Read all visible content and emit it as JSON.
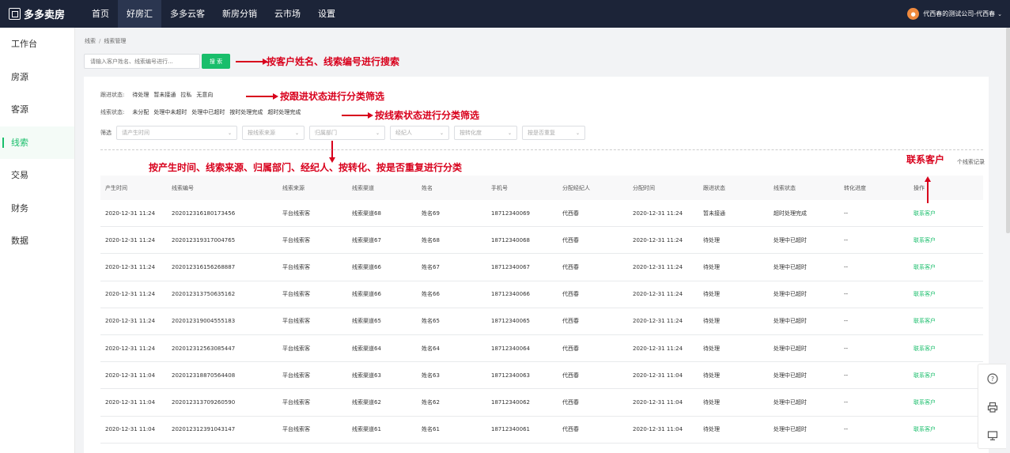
{
  "brand": {
    "name": "多多卖房"
  },
  "nav": {
    "items": [
      {
        "label": "首页"
      },
      {
        "label": "好房汇"
      },
      {
        "label": "多多云客"
      },
      {
        "label": "新房分销"
      },
      {
        "label": "云市场"
      },
      {
        "label": "设置"
      }
    ]
  },
  "user": {
    "name": "代西春的测试公司-代西春"
  },
  "sidebar": {
    "items": [
      {
        "label": "工作台"
      },
      {
        "label": "房源"
      },
      {
        "label": "客源"
      },
      {
        "label": "线索"
      },
      {
        "label": "交易"
      },
      {
        "label": "财务"
      },
      {
        "label": "数据"
      }
    ]
  },
  "breadcrumb": {
    "parent": "线索",
    "current": "线索管理"
  },
  "search": {
    "placeholder": "请输入客户姓名、线索编号进行...",
    "button": "搜 索"
  },
  "filters": {
    "follow_status": {
      "label": "跟进状态:",
      "options": [
        "待处理",
        "暂未接通",
        "拉私",
        "无意向"
      ]
    },
    "clue_status": {
      "label": "线索状态:",
      "options": [
        "未分配",
        "处理中未超时",
        "处理中已超时",
        "按时处理完成",
        "超时处理完成"
      ]
    },
    "screen_label": "筛选",
    "dropdowns": [
      "请产生时间",
      "按线索来源",
      "归属部门",
      "经纪人",
      "按转化度",
      "按是否重复"
    ]
  },
  "count_text": "个线索记录",
  "table": {
    "headers": [
      "产生时间",
      "线索编号",
      "线索来源",
      "线索渠道",
      "姓名",
      "手机号",
      "分配经纪人",
      "分配时间",
      "跟进状态",
      "线索状态",
      "转化进度",
      "操作"
    ],
    "rows": [
      [
        "2020-12-31 11:24",
        "2020123161801734​56",
        "平台线索客",
        "线索渠道68",
        "姓名69",
        "18712340069",
        "代西春",
        "2020-12-31 11:24",
        "暂未接通",
        "超时处理完成",
        "--",
        "联系客户"
      ],
      [
        "2020-12-31 11:24",
        "202012319317004765",
        "平台线索客",
        "线索渠道67",
        "姓名68",
        "18712340068",
        "代西春",
        "2020-12-31 11:24",
        "待处理",
        "处理中已超时",
        "--",
        "联系客户"
      ],
      [
        "2020-12-31 11:24",
        "202012316156268887",
        "平台线索客",
        "线索渠道66",
        "姓名67",
        "18712340067",
        "代西春",
        "2020-12-31 11:24",
        "待处理",
        "处理中已超时",
        "--",
        "联系客户"
      ],
      [
        "2020-12-31 11:24",
        "202012313750635162",
        "平台线索客",
        "线索渠道66",
        "姓名66",
        "18712340066",
        "代西春",
        "2020-12-31 11:24",
        "待处理",
        "处理中已超时",
        "--",
        "联系客户"
      ],
      [
        "2020-12-31 11:24",
        "202012319004555183",
        "平台线索客",
        "线索渠道65",
        "姓名65",
        "18712340065",
        "代西春",
        "2020-12-31 11:24",
        "待处理",
        "处理中已超时",
        "--",
        "联系客户"
      ],
      [
        "2020-12-31 11:24",
        "202012312563085447",
        "平台线索客",
        "线索渠道64",
        "姓名64",
        "18712340064",
        "代西春",
        "2020-12-31 11:24",
        "待处理",
        "处理中已超时",
        "--",
        "联系客户"
      ],
      [
        "2020-12-31 11:04",
        "202012318870564408",
        "平台线索客",
        "线索渠道63",
        "姓名63",
        "18712340063",
        "代西春",
        "2020-12-31 11:04",
        "待处理",
        "处理中已超时",
        "--",
        "联系客户"
      ],
      [
        "2020-12-31 11:04",
        "202012313709260590",
        "平台线索客",
        "线索渠道62",
        "姓名62",
        "18712340062",
        "代西春",
        "2020-12-31 11:04",
        "待处理",
        "处理中已超时",
        "--",
        "联系客户"
      ],
      [
        "2020-12-31 11:04",
        "202012312391043147",
        "平台线索客",
        "线索渠道61",
        "姓名61",
        "18712340061",
        "代西春",
        "2020-12-31 11:04",
        "待处理",
        "处理中已超时",
        "--",
        "联系客户"
      ]
    ]
  },
  "annotations": {
    "search": "按客户姓名、线索编号进行搜索",
    "follow": "按跟进状态进行分类筛选",
    "clue": "按线索状态进行分类筛选",
    "dropdowns": "按产生时间、线索来源、归属部门、经纪人、按转化、按是否重复进行分类",
    "contact": "联系客户"
  },
  "colors": {
    "accent": "#19be6b",
    "topbar": "#1c2438",
    "annotation": "#d8001c"
  },
  "icons": {
    "help": "question-icon",
    "print": "printer-icon",
    "screen": "monitor-icon"
  }
}
